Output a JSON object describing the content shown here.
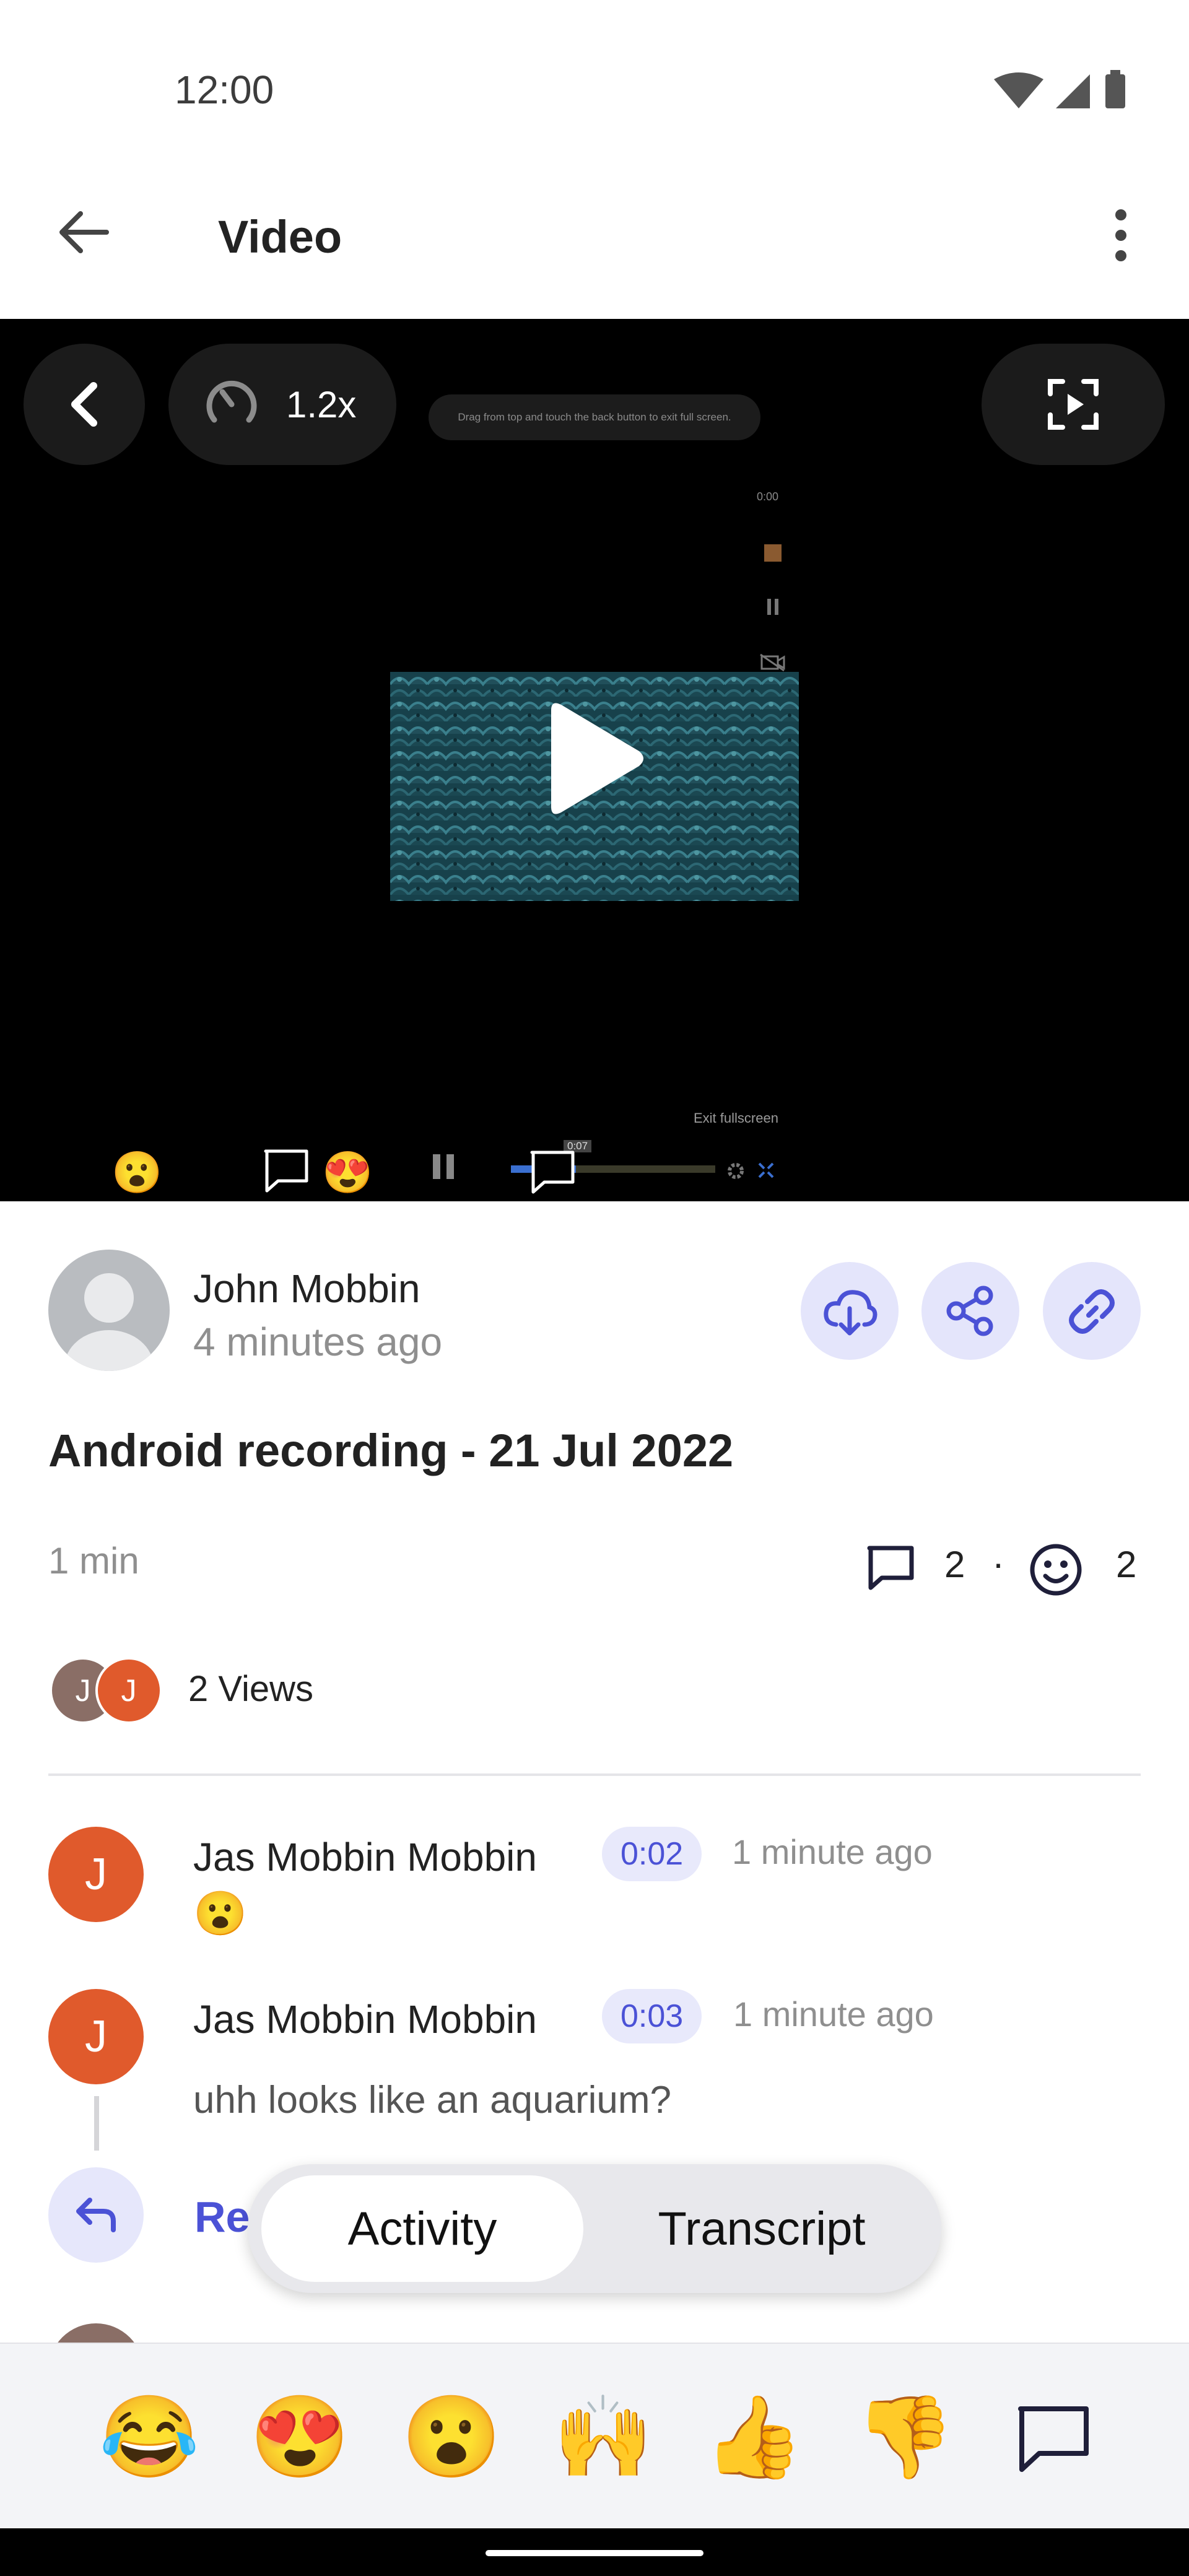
{
  "status_bar": {
    "time": "12:00"
  },
  "app_bar": {
    "title": "Video"
  },
  "video": {
    "speed": "1.2x",
    "hint": "Drag from top and touch the back button to exit full screen.",
    "timer": "0:00",
    "exit_label": "Exit fullscreen",
    "timeline_time": "0:07",
    "markers": [
      "😮",
      "😍"
    ]
  },
  "post": {
    "author": "John Mobbin",
    "posted": "4 minutes ago",
    "title": "Android recording - 21 Jul 2022",
    "duration": "1 min",
    "comment_count": "2",
    "separator": "·",
    "reaction_count": "2",
    "viewer_initials": [
      "J",
      "J"
    ],
    "views": "2 Views"
  },
  "comments": [
    {
      "initial": "J",
      "author": "Jas Mobbin Mobbin",
      "timestamp": "0:02",
      "time_ago": "1 minute ago",
      "body": "😮"
    },
    {
      "initial": "J",
      "author": "Jas Mobbin Mobbin",
      "timestamp": "0:03",
      "time_ago": "1 minute ago",
      "body": "uhh looks like an aquarium?"
    }
  ],
  "reply": {
    "label": "Re"
  },
  "tabs": [
    {
      "label": "Activity",
      "active": true
    },
    {
      "label": "Transcript",
      "active": false
    }
  ],
  "reactions": [
    "😂",
    "😍",
    "😮",
    "🙌",
    "👍",
    "👎"
  ],
  "colors": {
    "accent": "#4b52d6",
    "avatar_orange": "#e05a2c",
    "chip_bg": "#e8e9fb"
  }
}
